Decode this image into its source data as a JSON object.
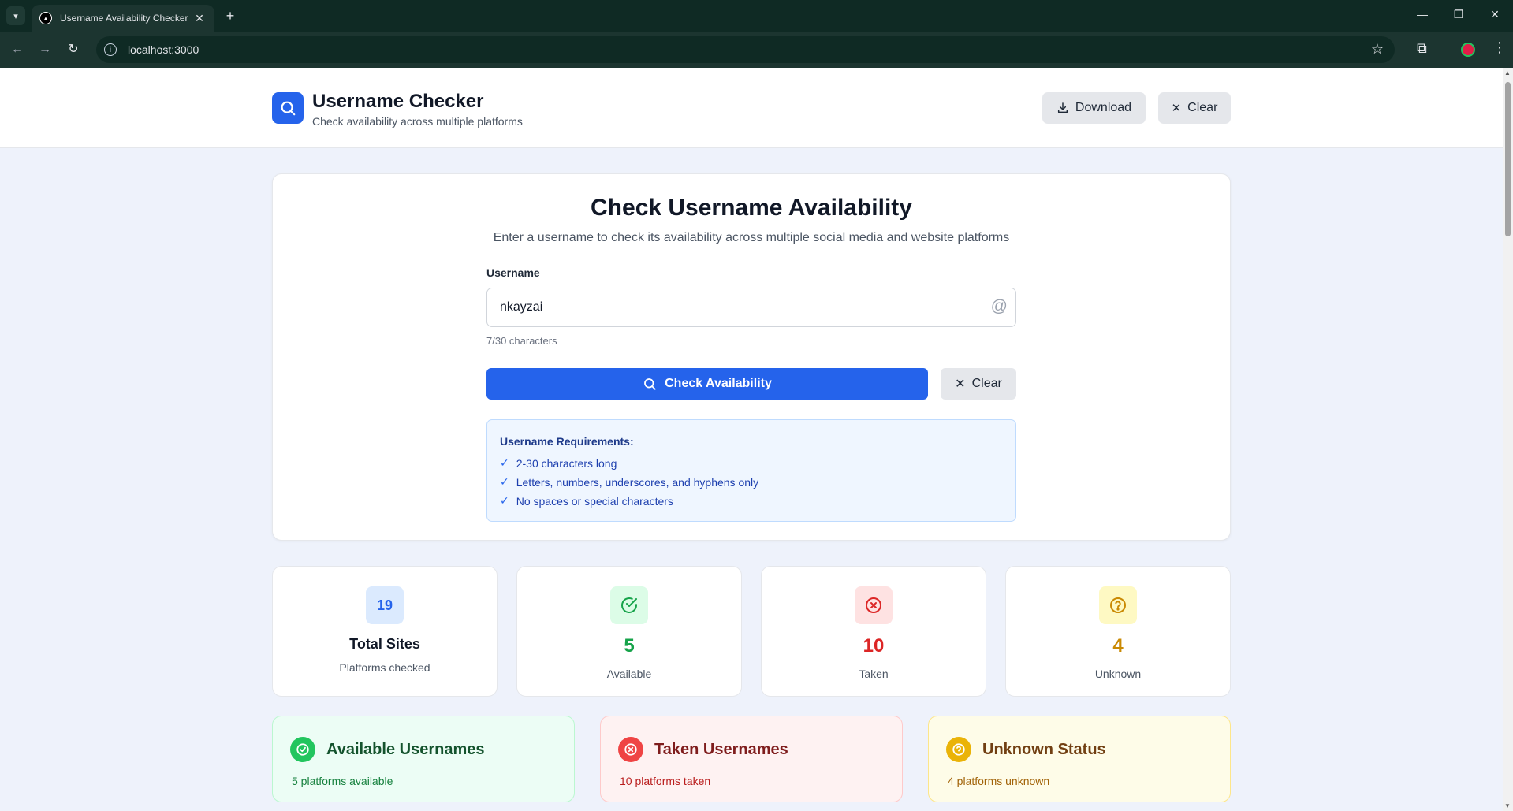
{
  "browser": {
    "tab_title": "Username Availability Checker",
    "url": "localhost:3000"
  },
  "header": {
    "title": "Username Checker",
    "subtitle": "Check availability across multiple platforms",
    "download_label": "Download",
    "clear_label": "Clear"
  },
  "checker": {
    "title": "Check Username Availability",
    "subtitle": "Enter a username to check its availability across multiple social media and website platforms",
    "field_label": "Username",
    "username_value": "nkayzai",
    "char_count": "7/30 characters",
    "check_label": "Check Availability",
    "clear_label": "Clear"
  },
  "requirements": {
    "title": "Username Requirements:",
    "items": [
      "2-30 characters long",
      "Letters, numbers, underscores, and hyphens only",
      "No spaces or special characters"
    ]
  },
  "stats": {
    "total": {
      "value": "19",
      "title": "Total Sites",
      "subtitle": "Platforms checked"
    },
    "available": {
      "value": "5",
      "label": "Available"
    },
    "taken": {
      "value": "10",
      "label": "Taken"
    },
    "unknown": {
      "value": "4",
      "label": "Unknown"
    }
  },
  "categories": {
    "available": {
      "title": "Available Usernames",
      "subtitle": "5 platforms available"
    },
    "taken": {
      "title": "Taken Usernames",
      "subtitle": "10 platforms taken"
    },
    "unknown": {
      "title": "Unknown Status",
      "subtitle": "4 platforms unknown"
    }
  },
  "colors": {
    "primary": "#2563eb",
    "available": "#16a34a",
    "taken": "#dc2626",
    "unknown": "#ca8a04"
  },
  "icons": [
    "search-icon",
    "download-icon",
    "close-icon",
    "at-icon",
    "check-icon",
    "check-circle-icon",
    "x-circle-icon",
    "question-circle-icon"
  ]
}
